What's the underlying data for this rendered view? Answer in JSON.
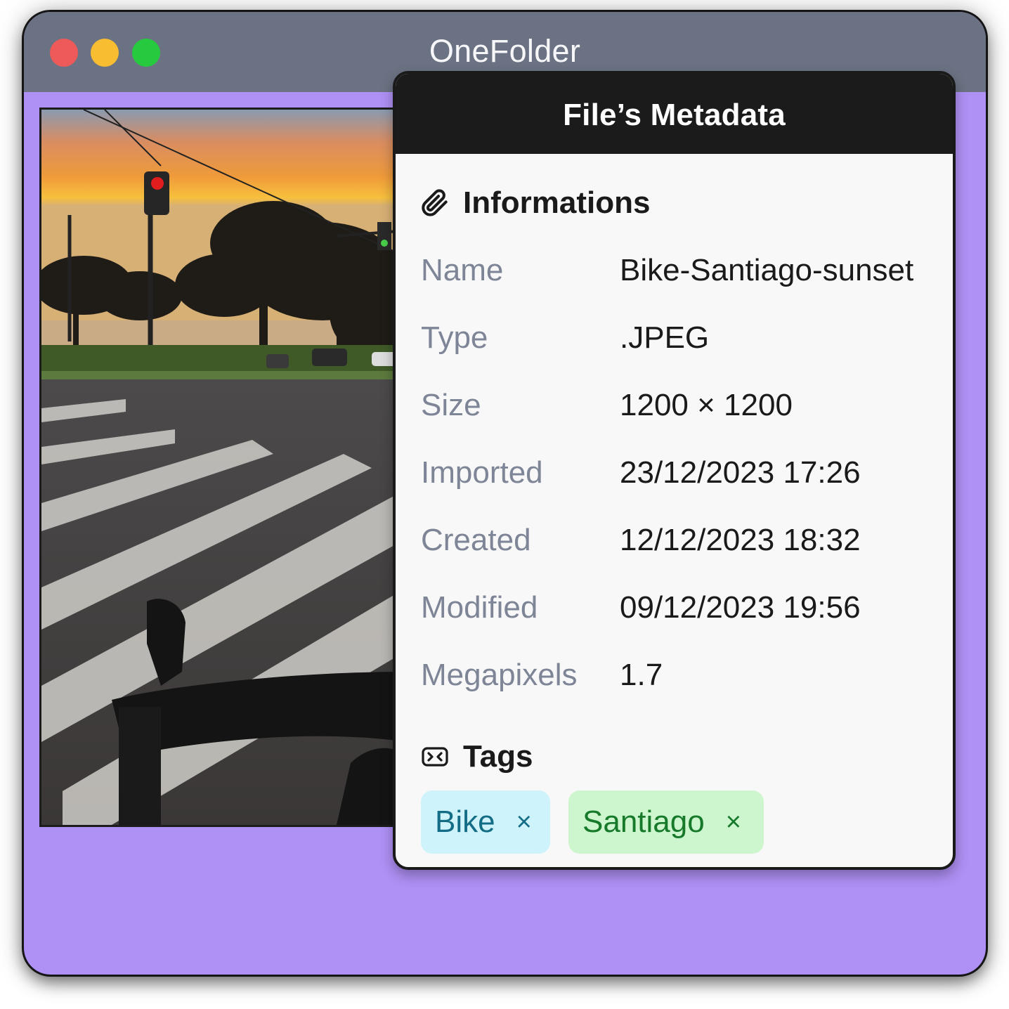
{
  "window": {
    "title": "OneFolder",
    "background_color": "#af90f5",
    "traffic_lights": [
      "close",
      "minimize",
      "maximize"
    ]
  },
  "preview": {
    "content": "sunset street photo with bicycle handlebar"
  },
  "metadata_panel": {
    "title": "File’s Metadata",
    "informations": {
      "heading": "Informations",
      "icon": "paperclip-icon",
      "rows": [
        {
          "label": "Name",
          "value": "Bike-Santiago-sunset"
        },
        {
          "label": "Type",
          "value": ".JPEG"
        },
        {
          "label": "Size",
          "value": "1200 × 1200"
        },
        {
          "label": "Imported",
          "value": "23/12/2023 17:26"
        },
        {
          "label": "Created",
          "value": "12/12/2023 18:32"
        },
        {
          "label": "Modified",
          "value": "09/12/2023 19:56"
        },
        {
          "label": "Megapixels",
          "value": "1.7"
        }
      ]
    },
    "tags": {
      "heading": "Tags",
      "icon": "tag-icon",
      "items": [
        {
          "label": "Bike",
          "remove": "×",
          "color": "#cff3fb"
        },
        {
          "label": "Santiago",
          "remove": "×",
          "color": "#cdf6cf"
        }
      ]
    }
  }
}
